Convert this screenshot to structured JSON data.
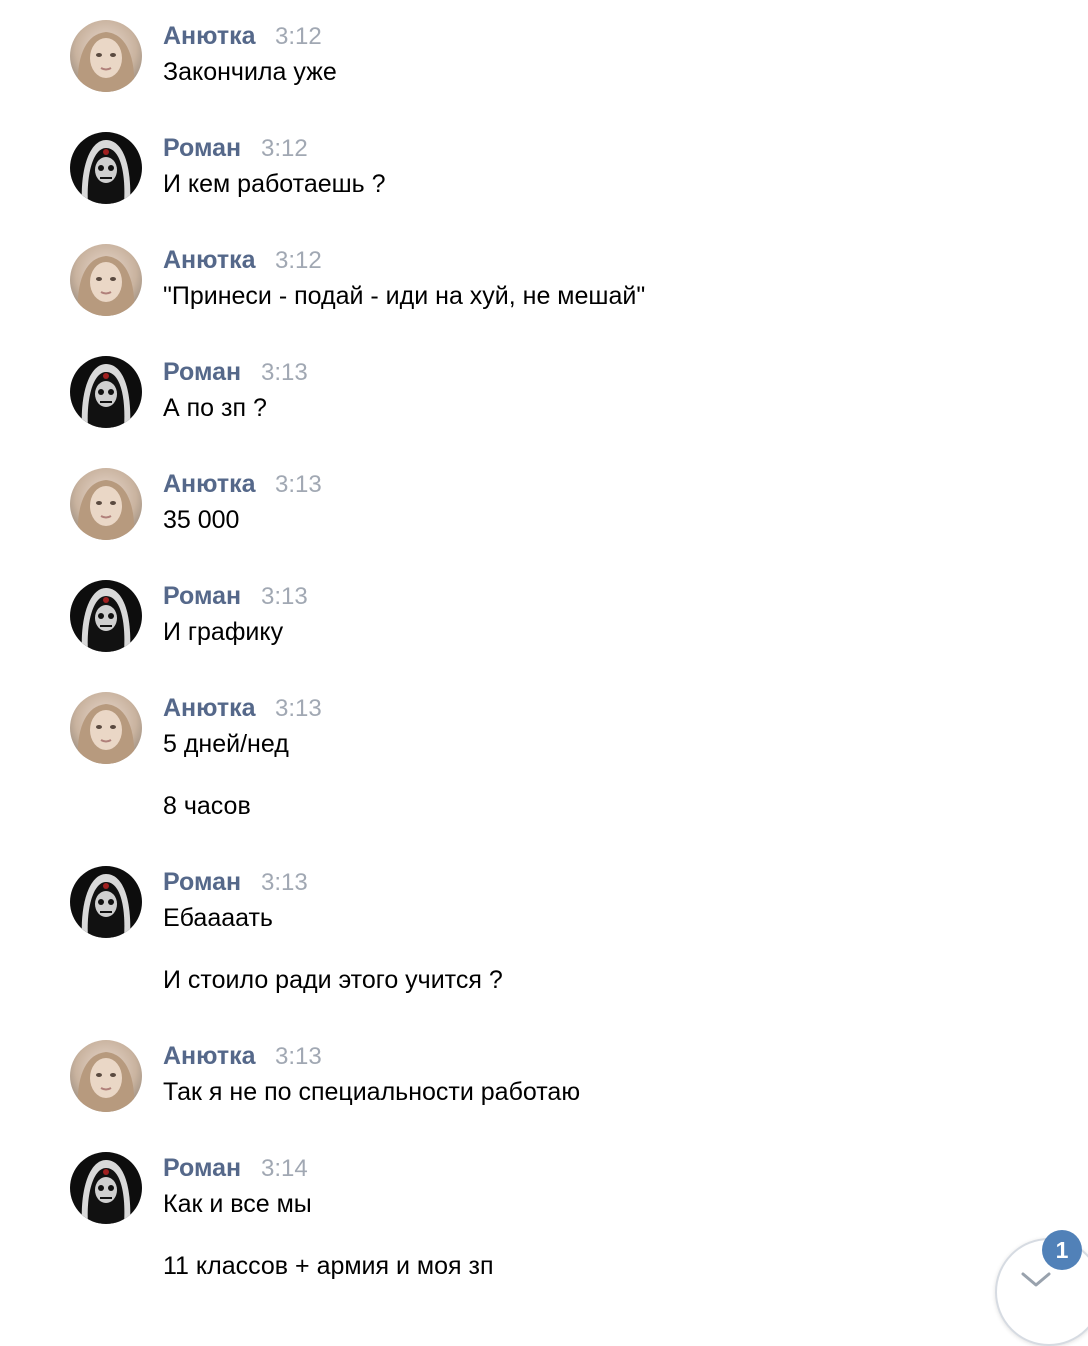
{
  "messages": [
    {
      "author": "Анютка",
      "avatar": "anyutka-avatar",
      "time": "3:12",
      "lines": [
        "Закончила уже"
      ]
    },
    {
      "author": "Роман",
      "avatar": "roman-avatar",
      "time": "3:12",
      "lines": [
        "И кем работаешь ?"
      ]
    },
    {
      "author": "Анютка",
      "avatar": "anyutka-avatar",
      "time": "3:12",
      "lines": [
        "\"Принеси - подай - иди на хуй, не мешай\""
      ]
    },
    {
      "author": "Роман",
      "avatar": "roman-avatar",
      "time": "3:13",
      "lines": [
        "А по зп ?"
      ]
    },
    {
      "author": "Анютка",
      "avatar": "anyutka-avatar",
      "time": "3:13",
      "lines": [
        "35 000"
      ]
    },
    {
      "author": "Роман",
      "avatar": "roman-avatar",
      "time": "3:13",
      "lines": [
        "И графику"
      ]
    },
    {
      "author": "Анютка",
      "avatar": "anyutka-avatar",
      "time": "3:13",
      "lines": [
        "5 дней/нед",
        "8 часов"
      ]
    },
    {
      "author": "Роман",
      "avatar": "roman-avatar",
      "time": "3:13",
      "lines": [
        "Ебаааать",
        "И стоило ради этого учится ?"
      ]
    },
    {
      "author": "Анютка",
      "avatar": "anyutka-avatar",
      "time": "3:13",
      "lines": [
        "Так я не по специальности работаю"
      ]
    },
    {
      "author": "Роман",
      "avatar": "roman-avatar",
      "time": "3:14",
      "lines": [
        "Как и все мы",
        "11 классов + армия и моя зп"
      ]
    }
  ],
  "scroll_down": {
    "icon": "chevron-down-icon",
    "unread_count": "1"
  },
  "colors": {
    "author": "#55688a",
    "time": "#a1a8b3",
    "text": "#000000",
    "badge": "#5181b8"
  }
}
